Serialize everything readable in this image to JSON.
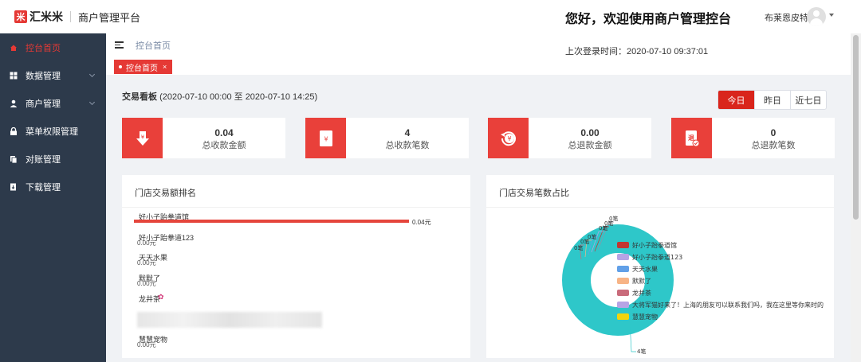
{
  "header": {
    "logo_mark": "米",
    "logo_text": "汇米米",
    "platform": "商户管理平台",
    "welcome": "您好，欢迎使用商户管理控台",
    "user_name": "布莱恩皮特"
  },
  "sidebar": {
    "items": [
      {
        "label": "控台首页",
        "icon": "home-icon",
        "active": true
      },
      {
        "label": "数据管理",
        "icon": "grid-icon",
        "expandable": true
      },
      {
        "label": "商户管理",
        "icon": "user-icon",
        "expandable": true
      },
      {
        "label": "菜单权限管理",
        "icon": "lock-icon"
      },
      {
        "label": "对账管理",
        "icon": "reconcile-icon"
      },
      {
        "label": "下载管理",
        "icon": "download-icon"
      }
    ]
  },
  "topbar": {
    "breadcrumb": "控台首页",
    "last_login": "上次登录时间：2020-07-10 09:37:01",
    "tab_label": "控台首页",
    "tab_close": "×"
  },
  "dashboard": {
    "title": "交易看板",
    "range": "(2020-07-10 00:00 至 2020-07-10 14:25)",
    "range_buttons": [
      "今日",
      "昨日",
      "近七日"
    ],
    "active_range": "今日",
    "accent_color": "#e9403a"
  },
  "stats": [
    {
      "value": "0.04",
      "label": "总收款金额",
      "icon": "receive-amount-icon"
    },
    {
      "value": "4",
      "label": "总收款笔数",
      "icon": "receive-count-icon"
    },
    {
      "value": "0.00",
      "label": "总退款金额",
      "icon": "refund-amount-icon"
    },
    {
      "value": "0",
      "label": "总退款笔数",
      "icon": "refund-count-icon"
    }
  ],
  "ranking": {
    "title": "门店交易额排名",
    "stores": [
      {
        "name": "好小子跆拳道馆",
        "value": "0.04元",
        "amount": 0.04
      },
      {
        "name": "好小子跆拳道123",
        "value": "0.00元",
        "amount": 0
      },
      {
        "name": "天天水果",
        "value": "0.00元",
        "amount": 0
      },
      {
        "name": "默默了",
        "value": "0.00元",
        "amount": 0
      },
      {
        "name": "龙井茶",
        "value": "",
        "amount": 0,
        "emoji": "✿"
      },
      {
        "name": "慧慧宠物",
        "value": "0.00元",
        "amount": 0
      }
    ]
  },
  "ratio": {
    "title": "门店交易笔数占比",
    "legend": [
      {
        "name": "好小子跆拳道馆",
        "color": "#c23531"
      },
      {
        "name": "好小子跆拳道123",
        "color": "#b7a4e5"
      },
      {
        "name": "天天水果",
        "color": "#61a0e8"
      },
      {
        "name": "默默了",
        "color": "#f7b486"
      },
      {
        "name": "龙井茶",
        "color": "#c96b7b"
      },
      {
        "name": "大将军猫好来了！上海的朋友可以联系我们吗，我在这里等你来时的",
        "color": "#b7a4e5"
      },
      {
        "name": "慧慧宠物",
        "color": "#f2d40d"
      }
    ],
    "slice_labels": [
      "0笔",
      "0笔",
      "0笔",
      "0笔",
      "0笔",
      "0笔",
      "4笔"
    ],
    "slice_values": [
      0,
      0,
      0,
      0,
      0,
      0,
      4
    ],
    "main_color": "#2ec7c9"
  }
}
